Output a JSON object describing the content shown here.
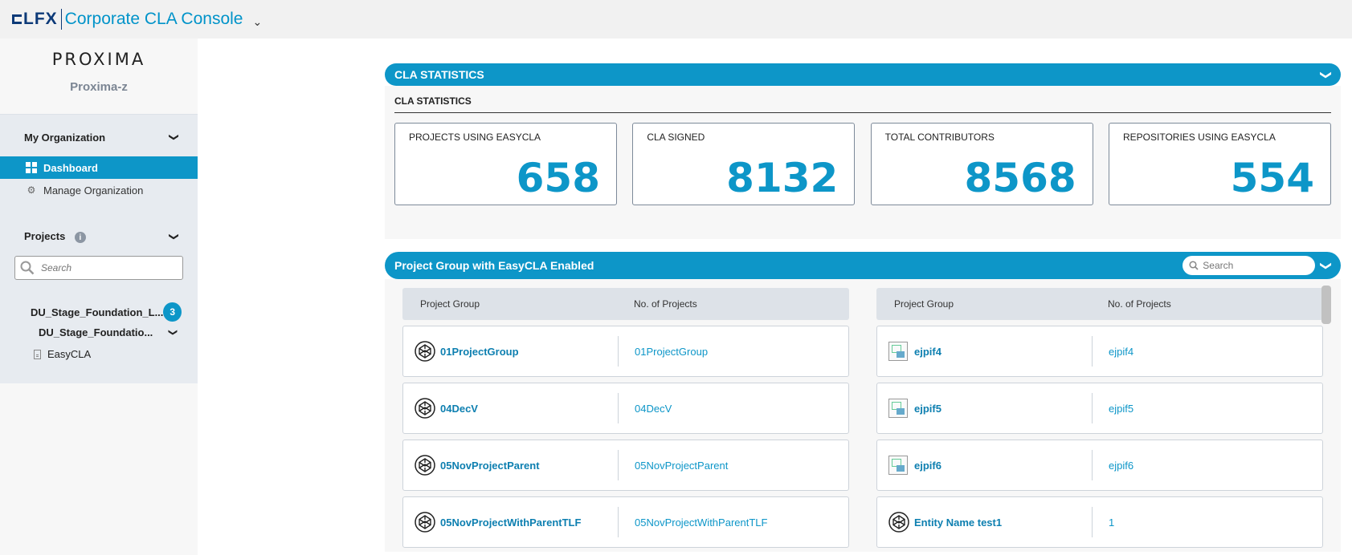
{
  "app": {
    "logo_text": "LFX",
    "title": "Corporate CLA Console"
  },
  "sidebar": {
    "brand": "PROXIMA",
    "org_name": "Proxima-z",
    "my_org_title": "My Organization",
    "nav": [
      {
        "label": "Dashboard",
        "active": true
      },
      {
        "label": "Manage Organization",
        "active": false
      }
    ],
    "projects_title": "Projects",
    "search_placeholder": "Search",
    "tree": {
      "foundation": "DU_Stage_Foundation_L...",
      "foundation_count": "3",
      "sub_foundation": "DU_Stage_Foundatio...",
      "project": "EasyCLA"
    }
  },
  "stats": {
    "band_title": "CLA STATISTICS",
    "section_label": "CLA STATISTICS",
    "cards": [
      {
        "label": "PROJECTS USING EASYCLA",
        "value": "658"
      },
      {
        "label": "CLA SIGNED",
        "value": "8132"
      },
      {
        "label": "TOTAL CONTRIBUTORS",
        "value": "8568"
      },
      {
        "label": "REPOSITORIES USING EASYCLA",
        "value": "554"
      }
    ]
  },
  "groups": {
    "band_title": "Project Group with EasyCLA Enabled",
    "search_placeholder": "Search",
    "col_header_group": "Project Group",
    "col_header_count": "No. of Projects",
    "left": [
      {
        "name": "01ProjectGroup",
        "count": "01ProjectGroup",
        "icon": "codepen-icon"
      },
      {
        "name": "04DecV",
        "count": "04DecV",
        "icon": "codepen-icon"
      },
      {
        "name": "05NovProjectParent",
        "count": "05NovProjectParent",
        "icon": "codepen-icon"
      },
      {
        "name": "05NovProjectWithParentTLF",
        "count": "05NovProjectWithParentTLF",
        "icon": "codepen-icon"
      }
    ],
    "right": [
      {
        "name": "ejpif4",
        "count": "ejpif4",
        "icon": "broken-image-icon"
      },
      {
        "name": "ejpif5",
        "count": "ejpif5",
        "icon": "broken-image-icon"
      },
      {
        "name": "ejpif6",
        "count": "ejpif6",
        "icon": "broken-image-icon"
      },
      {
        "name": "Entity Name test1",
        "count": "1",
        "icon": "codepen-icon"
      }
    ]
  },
  "colors": {
    "accent": "#0d96c8",
    "logo": "#0d3a78",
    "sidebar_bg": "#e7ebf0"
  }
}
